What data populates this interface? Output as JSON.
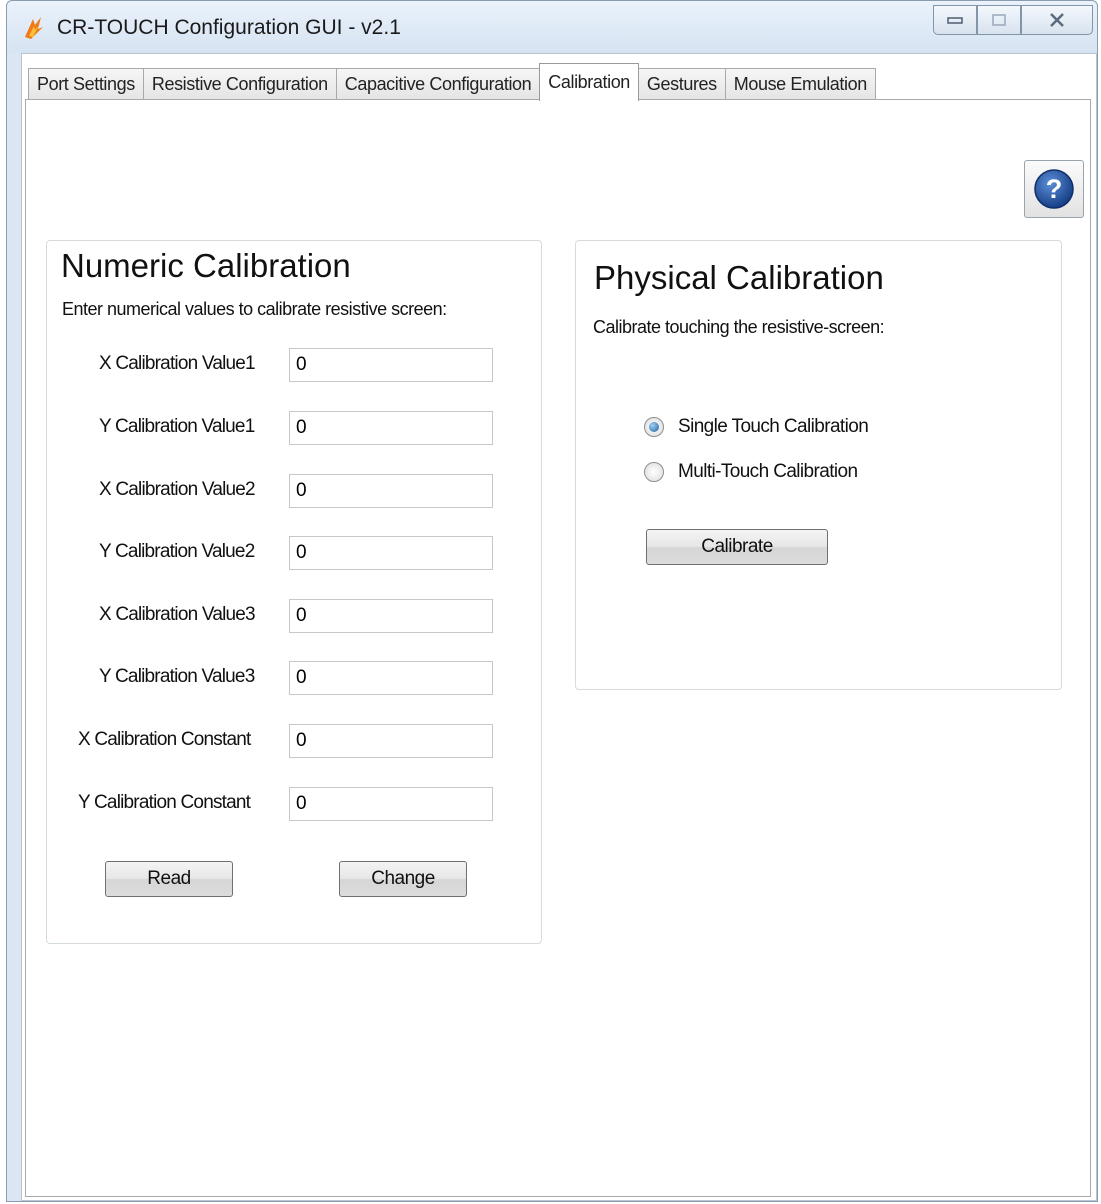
{
  "window": {
    "title": "CR-TOUCH Configuration GUI - v2.1"
  },
  "tabs": [
    {
      "label": "Port Settings",
      "active": false
    },
    {
      "label": "Resistive Configuration",
      "active": false
    },
    {
      "label": "Capacitive Configuration",
      "active": false
    },
    {
      "label": "Calibration",
      "active": true
    },
    {
      "label": "Gestures",
      "active": false
    },
    {
      "label": "Mouse Emulation",
      "active": false
    }
  ],
  "numeric": {
    "title": "Numeric Calibration",
    "subtitle": "Enter numerical values to calibrate resistive screen:",
    "fields": [
      {
        "label": "X Calibration Value1",
        "value": "0"
      },
      {
        "label": "Y Calibration Value1",
        "value": "0"
      },
      {
        "label": "X Calibration Value2",
        "value": "0"
      },
      {
        "label": "Y Calibration Value2",
        "value": "0"
      },
      {
        "label": "X Calibration Value3",
        "value": "0"
      },
      {
        "label": "Y Calibration Value3",
        "value": "0"
      },
      {
        "label": "X Calibration Constant",
        "value": "0"
      },
      {
        "label": "Y Calibration Constant",
        "value": "0"
      }
    ],
    "read_label": "Read",
    "change_label": "Change"
  },
  "physical": {
    "title": "Physical Calibration",
    "subtitle": "Calibrate touching the resistive-screen:",
    "options": [
      {
        "label": "Single Touch Calibration",
        "selected": true
      },
      {
        "label": "Multi-Touch Calibration",
        "selected": false
      }
    ],
    "calibrate_label": "Calibrate"
  },
  "icons": {
    "app": "flame-logo-icon",
    "help": "help-question-icon",
    "minimize": "minimize-icon",
    "maximize": "maximize-icon",
    "close": "close-icon"
  },
  "colors": {
    "accent": "#1e5aa8",
    "logo": "#f07a1a"
  }
}
